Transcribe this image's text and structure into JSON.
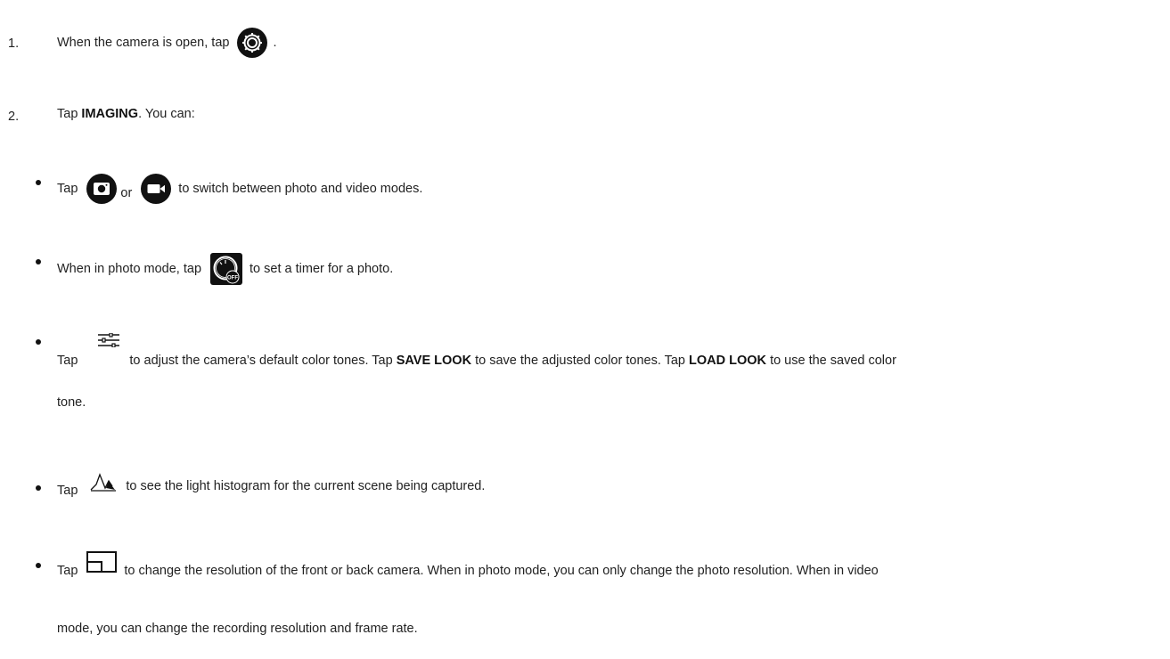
{
  "step1": {
    "number": "1.",
    "before": "When the camera is open, tap",
    "after": ".",
    "icon": "gear-icon"
  },
  "step2": {
    "number": "2.",
    "before": "Tap",
    "strong": "IMAGING",
    "after": ". You can:"
  },
  "bullets": {
    "mode": {
      "tap": "Tap",
      "or": "or",
      "after": "to switch between photo and video modes.",
      "icons": [
        "camera-icon",
        "video-icon"
      ]
    },
    "timer": {
      "before": "When in photo mode, tap",
      "after": "to set a timer for a photo.",
      "icon": "timer-off-icon",
      "icon_label": "OFF"
    },
    "color": {
      "tap1": "Tap",
      "text1": "to adjust the camera’s default color tones. Tap",
      "save": "SAVE LOOK",
      "text2": "to save the adjusted color tones. Tap",
      "load": "LOAD LOOK",
      "text3": "to use the saved color",
      "line2": "tone.",
      "icon": "sliders-icon"
    },
    "histogram": {
      "tap": "Tap",
      "after": "to see the light histogram for the current scene being captured.",
      "icon": "histogram-icon"
    },
    "resolution": {
      "tap": "Tap",
      "after": "to change the resolution of the front or back camera. When in photo mode, you can only change the photo resolution. When in video",
      "line2": "mode, you can change the recording resolution and frame rate.",
      "icon": "resolution-icon"
    }
  }
}
